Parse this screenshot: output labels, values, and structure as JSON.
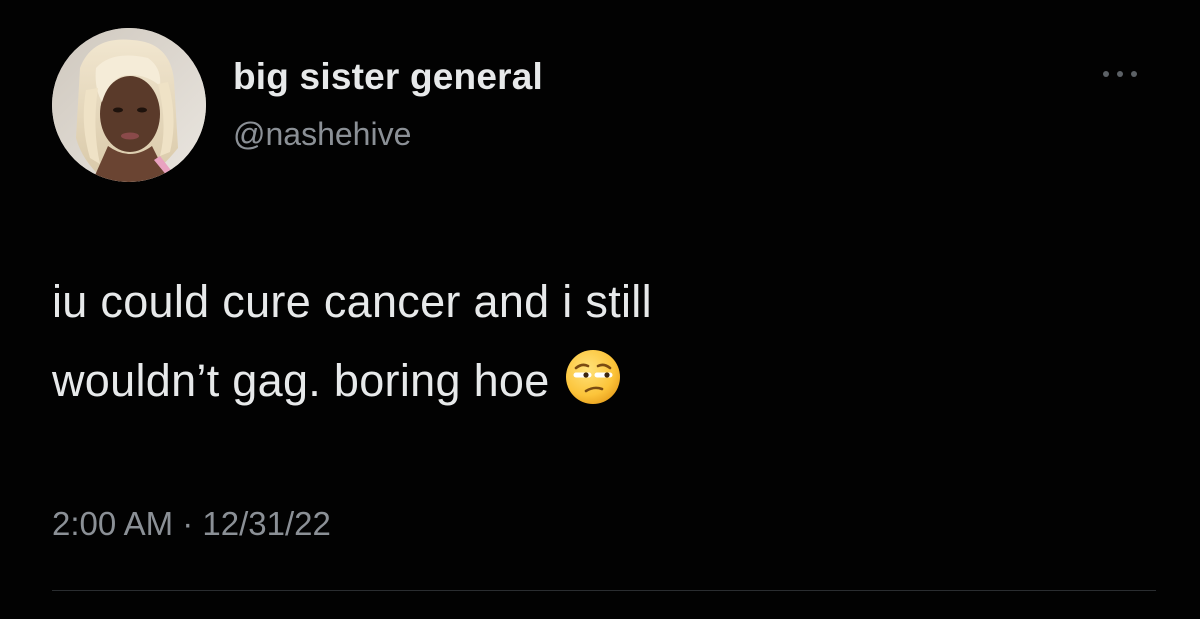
{
  "tweet": {
    "author": {
      "display_name": "big sister general",
      "handle": "@nashehive",
      "avatar_icon": "profile-photo"
    },
    "text_lines": [
      "iu could cure cancer and i still",
      "wouldn’t gag. boring hoe"
    ],
    "emoji": "unamused-face-emoji",
    "timestamp": "2:00 AM · 12/31/22",
    "more_icon": "more-options-icon"
  },
  "colors": {
    "background": "#000000",
    "text": "#e7e9ea",
    "secondary_text": "#8b9096",
    "divider": "#2a2d30"
  }
}
